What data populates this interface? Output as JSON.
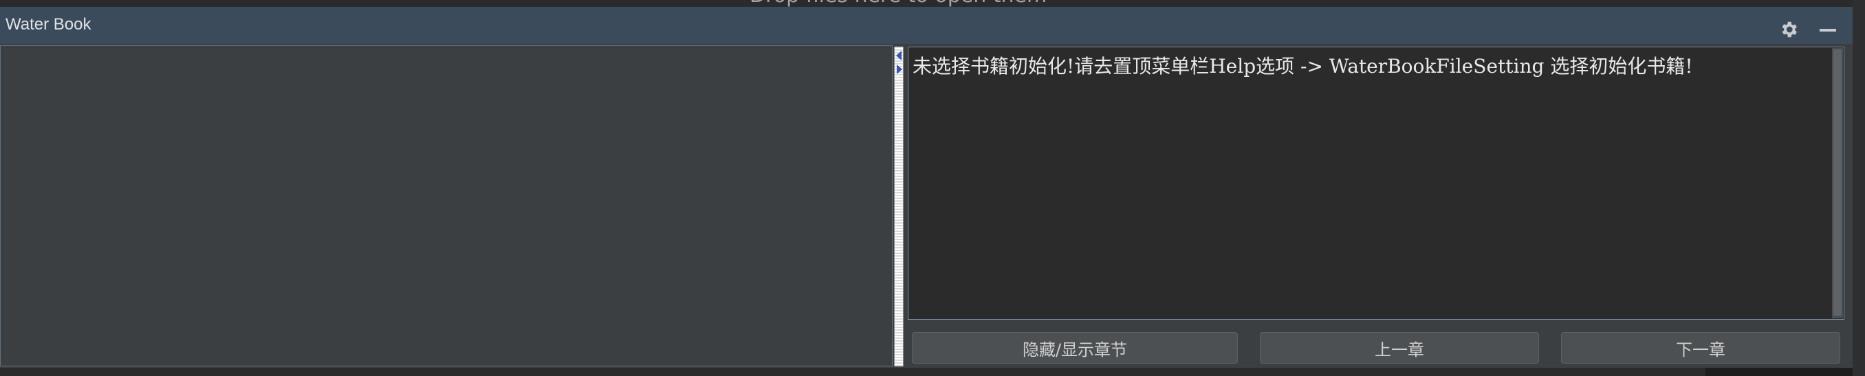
{
  "window": {
    "title": "Water Book",
    "drop_hint": "Drop files here to open them"
  },
  "icons": {
    "settings": "gear-icon",
    "minimize": "minimize-icon"
  },
  "reader": {
    "notice": "未选择书籍初始化!请去置顶菜单栏Help选项 -> WaterBookFileSetting 选择初始化书籍!"
  },
  "buttons": {
    "toggle_chapters": "隐藏/显示章节",
    "prev_chapter": "上一章",
    "next_chapter": "下一章"
  },
  "colors": {
    "titlebar": "#3c4b5b",
    "panel": "#3c3f41",
    "editor": "#2b2b2b",
    "accent_border": "#627384"
  }
}
